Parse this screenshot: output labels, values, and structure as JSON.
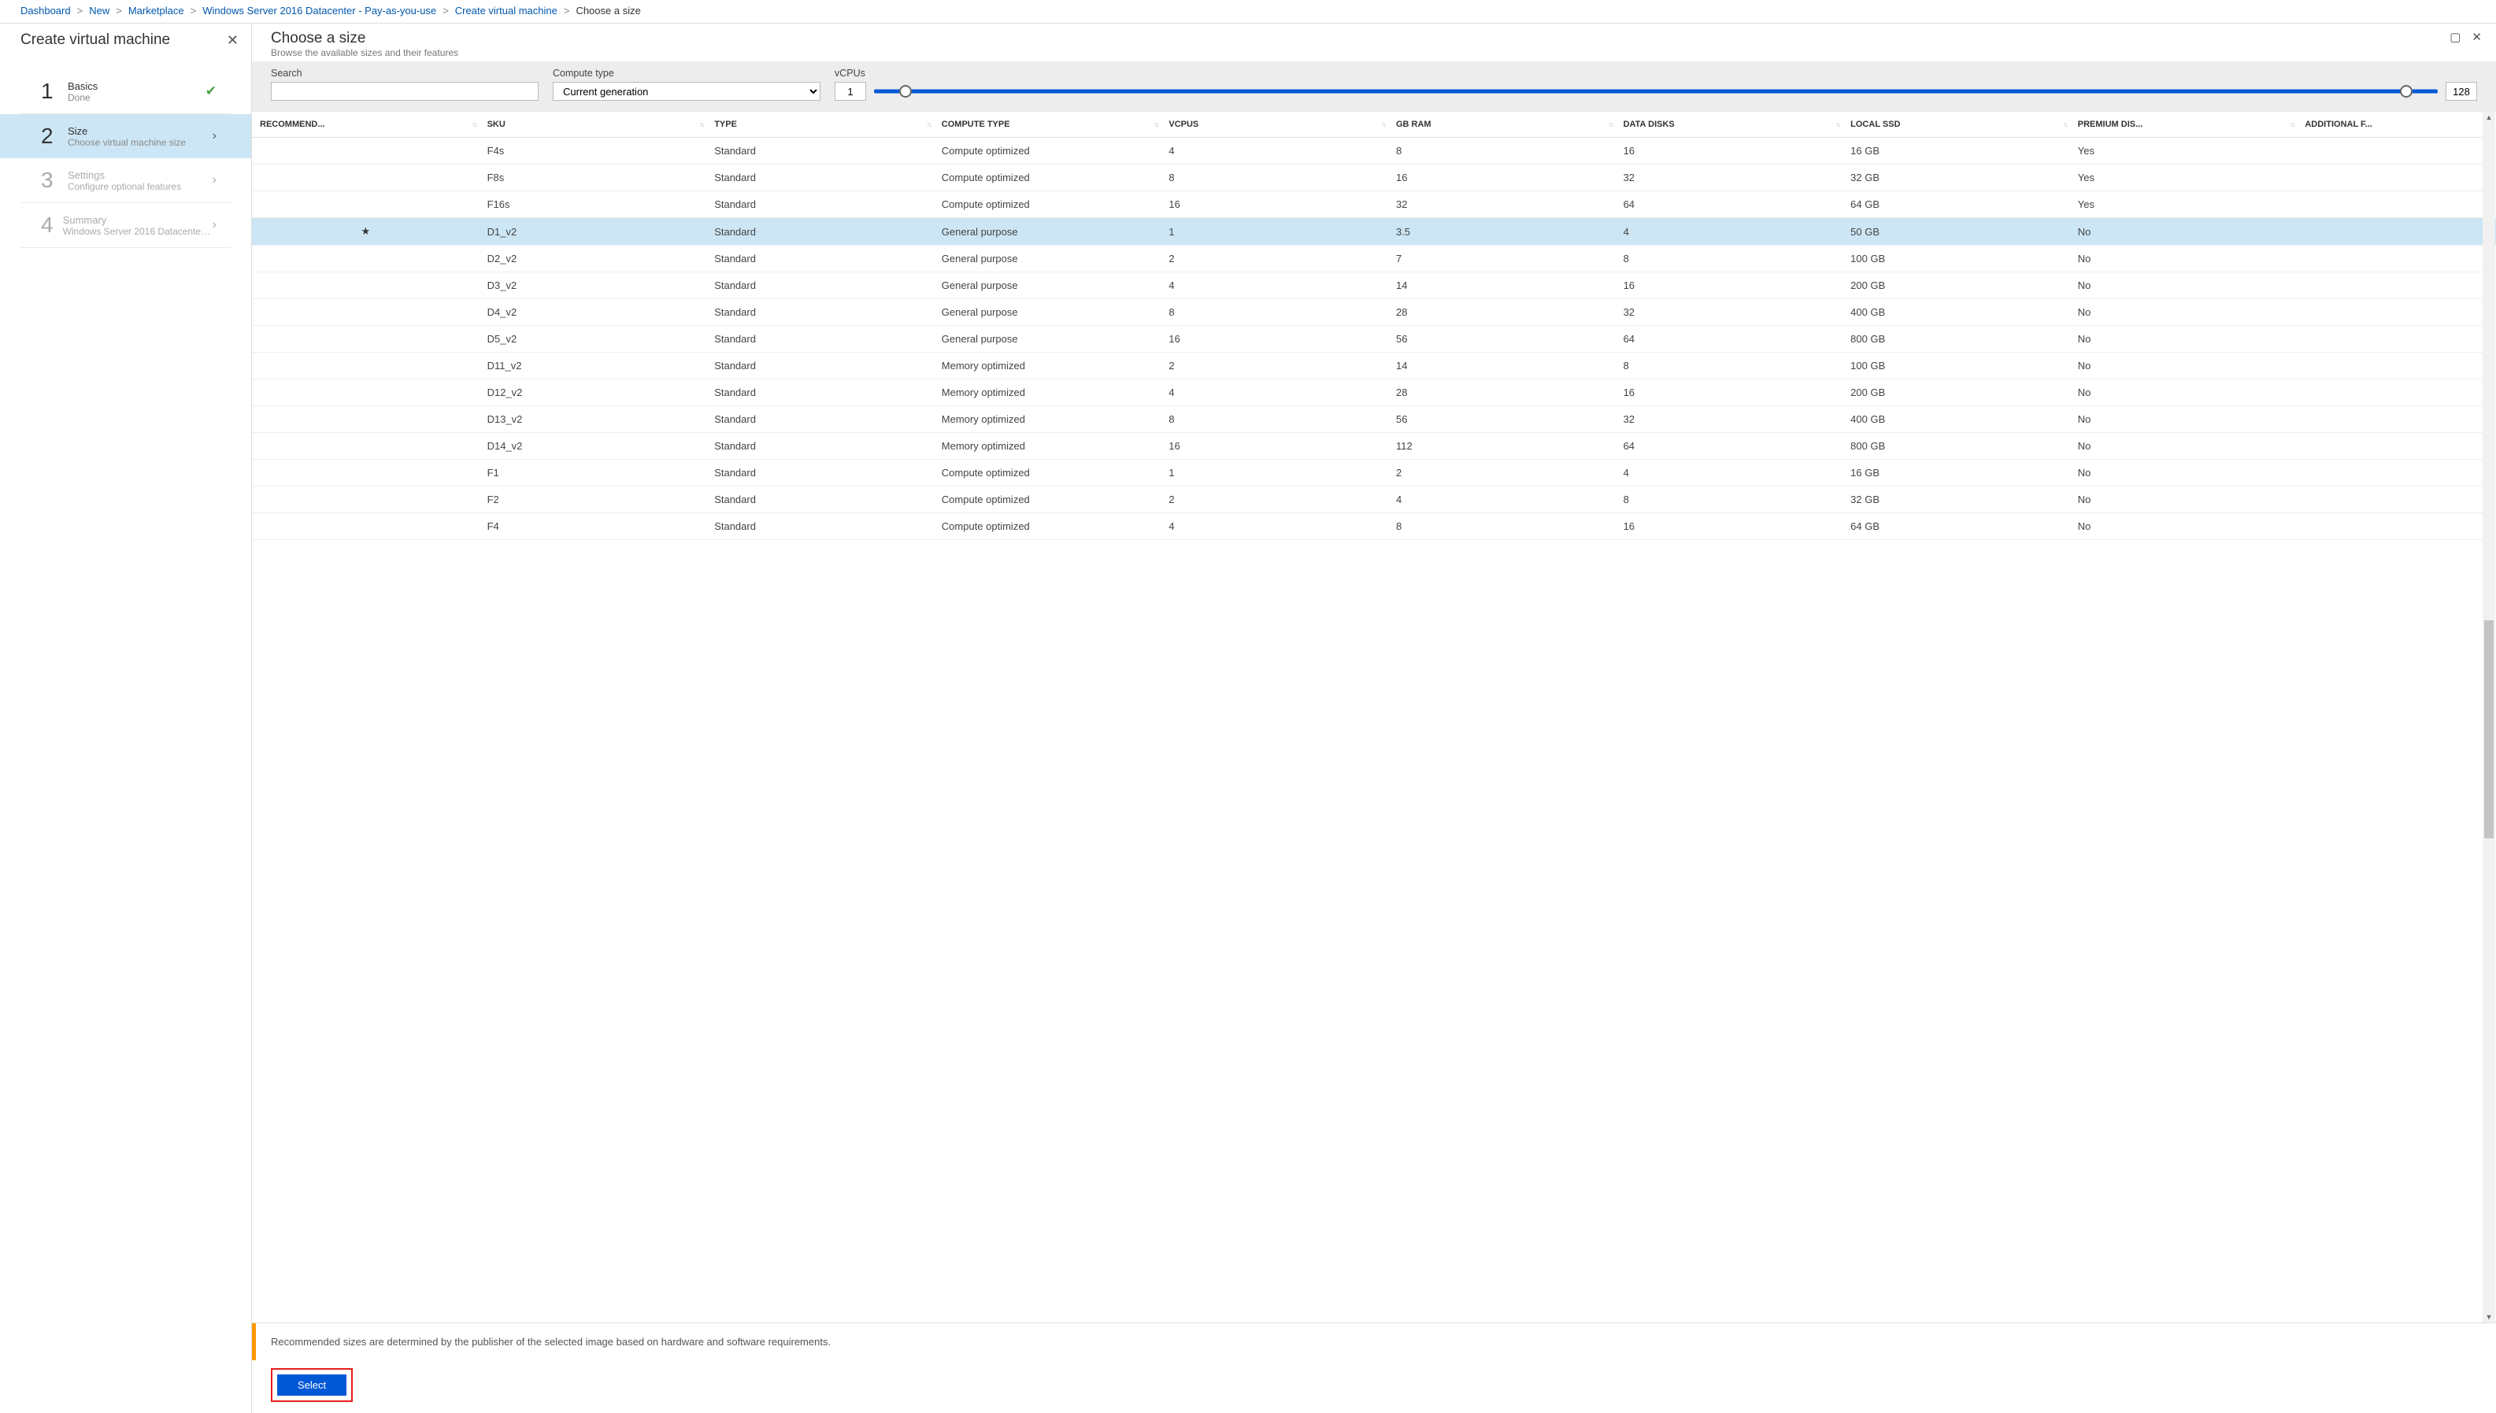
{
  "breadcrumb": [
    {
      "label": "Dashboard",
      "link": true
    },
    {
      "label": "New",
      "link": true
    },
    {
      "label": "Marketplace",
      "link": true
    },
    {
      "label": "Windows Server 2016 Datacenter - Pay-as-you-use",
      "link": true
    },
    {
      "label": "Create virtual machine",
      "link": true
    },
    {
      "label": "Choose a size",
      "link": false
    }
  ],
  "left": {
    "title": "Create virtual machine",
    "steps": [
      {
        "num": "1",
        "title": "Basics",
        "sub": "Done",
        "state": "done"
      },
      {
        "num": "2",
        "title": "Size",
        "sub": "Choose virtual machine size",
        "state": "selected"
      },
      {
        "num": "3",
        "title": "Settings",
        "sub": "Configure optional features",
        "state": "disabled"
      },
      {
        "num": "4",
        "title": "Summary",
        "sub": "Windows Server 2016 Datacenter ...",
        "state": "disabled"
      }
    ]
  },
  "right": {
    "title": "Choose a size",
    "subtitle": "Browse the available sizes and their features",
    "filters": {
      "search_label": "Search",
      "search_value": "",
      "compute_label": "Compute type",
      "compute_value": "Current generation",
      "vcpu_label": "vCPUs",
      "vcpu_min": "1",
      "vcpu_max": "128"
    },
    "columns": [
      "RECOMMEND...",
      "SKU",
      "TYPE",
      "COMPUTE TYPE",
      "VCPUS",
      "GB RAM",
      "DATA DISKS",
      "LOCAL SSD",
      "PREMIUM DIS...",
      "ADDITIONAL F..."
    ],
    "rows": [
      {
        "rec": "",
        "sku": "F4s",
        "type": "Standard",
        "ctype": "Compute optimized",
        "vcpu": "4",
        "ram": "8",
        "disks": "16",
        "ssd": "16 GB",
        "prem": "Yes"
      },
      {
        "rec": "",
        "sku": "F8s",
        "type": "Standard",
        "ctype": "Compute optimized",
        "vcpu": "8",
        "ram": "16",
        "disks": "32",
        "ssd": "32 GB",
        "prem": "Yes"
      },
      {
        "rec": "",
        "sku": "F16s",
        "type": "Standard",
        "ctype": "Compute optimized",
        "vcpu": "16",
        "ram": "32",
        "disks": "64",
        "ssd": "64 GB",
        "prem": "Yes"
      },
      {
        "rec": "★",
        "sku": "D1_v2",
        "type": "Standard",
        "ctype": "General purpose",
        "vcpu": "1",
        "ram": "3.5",
        "disks": "4",
        "ssd": "50 GB",
        "prem": "No",
        "selected": true
      },
      {
        "rec": "",
        "sku": "D2_v2",
        "type": "Standard",
        "ctype": "General purpose",
        "vcpu": "2",
        "ram": "7",
        "disks": "8",
        "ssd": "100 GB",
        "prem": "No"
      },
      {
        "rec": "",
        "sku": "D3_v2",
        "type": "Standard",
        "ctype": "General purpose",
        "vcpu": "4",
        "ram": "14",
        "disks": "16",
        "ssd": "200 GB",
        "prem": "No"
      },
      {
        "rec": "",
        "sku": "D4_v2",
        "type": "Standard",
        "ctype": "General purpose",
        "vcpu": "8",
        "ram": "28",
        "disks": "32",
        "ssd": "400 GB",
        "prem": "No"
      },
      {
        "rec": "",
        "sku": "D5_v2",
        "type": "Standard",
        "ctype": "General purpose",
        "vcpu": "16",
        "ram": "56",
        "disks": "64",
        "ssd": "800 GB",
        "prem": "No"
      },
      {
        "rec": "",
        "sku": "D11_v2",
        "type": "Standard",
        "ctype": "Memory optimized",
        "vcpu": "2",
        "ram": "14",
        "disks": "8",
        "ssd": "100 GB",
        "prem": "No"
      },
      {
        "rec": "",
        "sku": "D12_v2",
        "type": "Standard",
        "ctype": "Memory optimized",
        "vcpu": "4",
        "ram": "28",
        "disks": "16",
        "ssd": "200 GB",
        "prem": "No"
      },
      {
        "rec": "",
        "sku": "D13_v2",
        "type": "Standard",
        "ctype": "Memory optimized",
        "vcpu": "8",
        "ram": "56",
        "disks": "32",
        "ssd": "400 GB",
        "prem": "No"
      },
      {
        "rec": "",
        "sku": "D14_v2",
        "type": "Standard",
        "ctype": "Memory optimized",
        "vcpu": "16",
        "ram": "112",
        "disks": "64",
        "ssd": "800 GB",
        "prem": "No"
      },
      {
        "rec": "",
        "sku": "F1",
        "type": "Standard",
        "ctype": "Compute optimized",
        "vcpu": "1",
        "ram": "2",
        "disks": "4",
        "ssd": "16 GB",
        "prem": "No"
      },
      {
        "rec": "",
        "sku": "F2",
        "type": "Standard",
        "ctype": "Compute optimized",
        "vcpu": "2",
        "ram": "4",
        "disks": "8",
        "ssd": "32 GB",
        "prem": "No"
      },
      {
        "rec": "",
        "sku": "F4",
        "type": "Standard",
        "ctype": "Compute optimized",
        "vcpu": "4",
        "ram": "8",
        "disks": "16",
        "ssd": "64 GB",
        "prem": "No"
      }
    ],
    "info": "Recommended sizes are determined by the publisher of the selected image based on hardware and software requirements.",
    "select_label": "Select"
  }
}
